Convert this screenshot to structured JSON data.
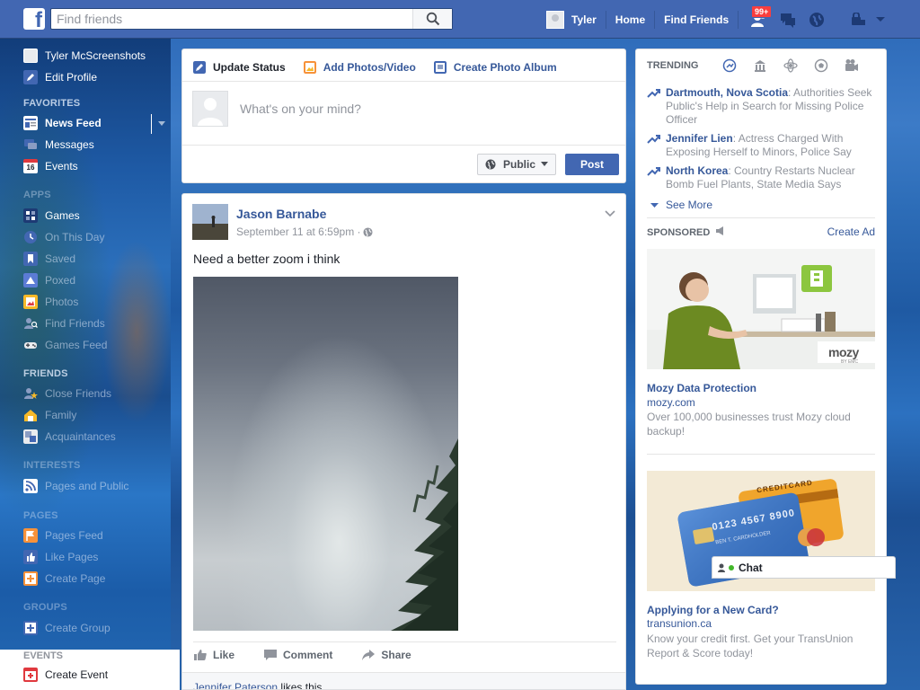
{
  "header": {
    "search_placeholder": "Find friends",
    "user_name": "Tyler",
    "nav_home": "Home",
    "nav_find_friends": "Find Friends",
    "notification_badge": "99+"
  },
  "sidebar": {
    "profile_name": "Tyler McScreenshots",
    "edit_profile": "Edit Profile",
    "favorites_heading": "FAVORITES",
    "favorites": [
      {
        "label": "News Feed"
      },
      {
        "label": "Messages"
      },
      {
        "label": "Events"
      }
    ],
    "events_badge": "16",
    "apps_heading": "APPS",
    "apps": [
      {
        "label": "Games"
      },
      {
        "label": "On This Day"
      },
      {
        "label": "Saved"
      },
      {
        "label": "Poxed"
      },
      {
        "label": "Photos"
      },
      {
        "label": "Find Friends"
      },
      {
        "label": "Games Feed"
      }
    ],
    "friends_heading": "FRIENDS",
    "friends": [
      {
        "label": "Close Friends"
      },
      {
        "label": "Family"
      },
      {
        "label": "Acquaintances"
      }
    ],
    "interests_heading": "INTERESTS",
    "interests": [
      {
        "label": "Pages and Public"
      }
    ],
    "pages_heading": "PAGES",
    "pages": [
      {
        "label": "Pages Feed"
      },
      {
        "label": "Like Pages"
      },
      {
        "label": "Create Page"
      }
    ],
    "groups_heading": "GROUPS",
    "groups": [
      {
        "label": "Create Group"
      }
    ],
    "events_heading": "EVENTS",
    "events": [
      {
        "label": "Create Event"
      }
    ]
  },
  "composer": {
    "tab_update": "Update Status",
    "tab_photos": "Add Photos/Video",
    "tab_album": "Create Photo Album",
    "placeholder": "What's on your mind?",
    "audience": "Public",
    "post_label": "Post"
  },
  "story": {
    "author": "Jason Barnabe",
    "timestamp": "September 11 at 6:59pm · ",
    "text": "Need a better zoom i think",
    "like": "Like",
    "comment": "Comment",
    "share": "Share",
    "liker": "Jennifer Paterson",
    "likes_suffix": " likes this."
  },
  "trending": {
    "heading": "TRENDING",
    "items": [
      {
        "name": "Dartmouth, Nova Scotia",
        "text": ": Authorities Seek Public's Help in Search for Missing Police Officer"
      },
      {
        "name": "Jennifer Lien",
        "text": ": Actress Charged With Exposing Herself to Minors, Police Say"
      },
      {
        "name": "North Korea",
        "text": ": Country Restarts Nuclear Bomb Fuel Plants, State Media Says"
      }
    ],
    "see_more": "See More"
  },
  "ads": {
    "sponsored_heading": "SPONSORED",
    "create_ad": "Create Ad",
    "ad1": {
      "title": "Mozy Data Protection",
      "domain": "mozy.com",
      "text": "Over 100,000 businesses trust Mozy cloud backup!",
      "brand": "mozy",
      "brand_sub": "BY EMC"
    },
    "ad2": {
      "title": "Applying for a New Card?",
      "domain": "transunion.ca",
      "text": "Know your credit first. Get your TransUnion Report & Score today!",
      "card_number": "0123 4567 8900",
      "card_name": "BEN T. CARDHOLDER",
      "card_label": "CREDITCARD"
    }
  },
  "chat": {
    "label": "Chat"
  },
  "colors": {
    "brand_blue": "#4267b2",
    "link_blue": "#365899",
    "badge_red": "#fa3e3e",
    "online_green": "#42b72a"
  }
}
